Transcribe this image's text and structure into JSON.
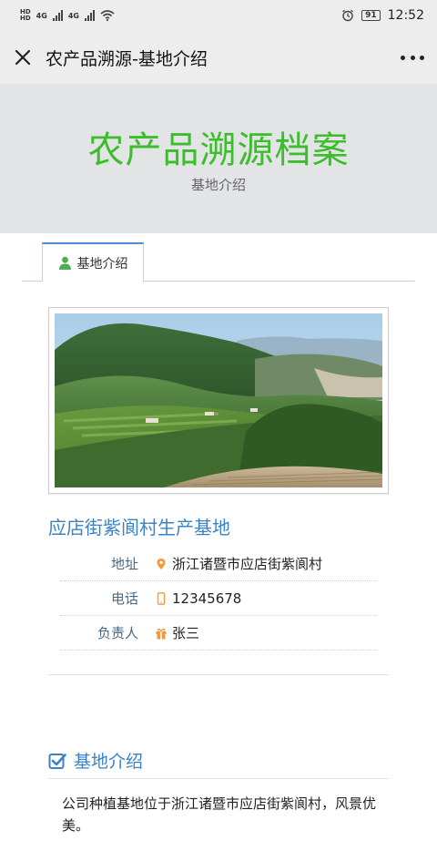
{
  "status_bar": {
    "sim1_tag": "HD",
    "sim2_tag": "HD",
    "net1": "4G",
    "net2": "4G",
    "battery": "91",
    "time": "12:52",
    "icons": [
      "signal-icon",
      "wifi-icon",
      "alarm-icon",
      "battery-icon"
    ]
  },
  "nav": {
    "title": "农产品溯源-基地介绍",
    "close_icon": "close-icon",
    "more_icon": "more-icon"
  },
  "banner": {
    "title": "农产品溯源档案",
    "subtitle": "基地介绍",
    "title_color": "#3cbd2b"
  },
  "tabs": [
    {
      "label": "基地介绍",
      "icon": "user-icon",
      "active": true
    }
  ],
  "base": {
    "name": "应店街紫阆村生产基地",
    "name_color": "#3a83c4",
    "fields": [
      {
        "label": "地址",
        "icon": "location-icon",
        "value": "浙江诸暨市应店街紫阆村"
      },
      {
        "label": "电话",
        "icon": "phone-icon",
        "value": "12345678"
      },
      {
        "label": "负责人",
        "icon": "gift-icon",
        "value": "张三"
      }
    ]
  },
  "intro": {
    "heading": "基地介绍",
    "heading_icon": "checkbox-icon",
    "text": "公司种植基地位于浙江诸暨市应店街紫阆村，风景优美。"
  }
}
